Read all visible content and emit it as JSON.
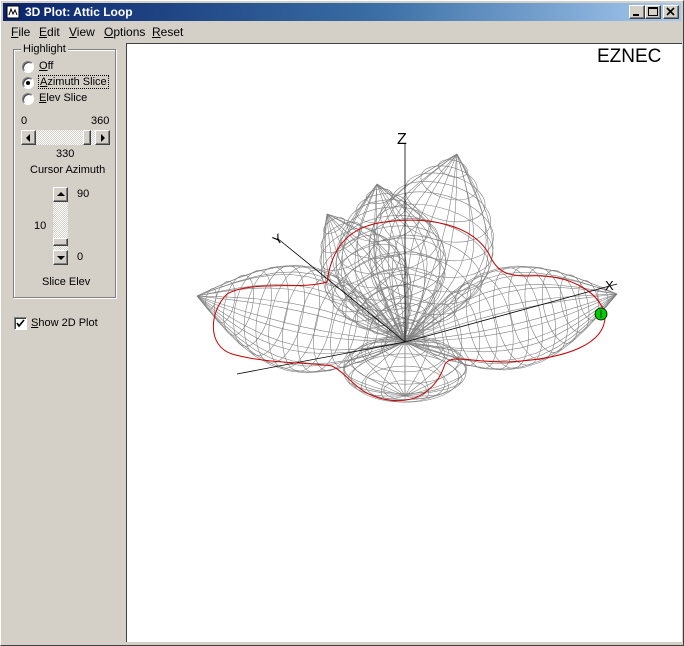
{
  "window": {
    "title": "3D Plot: Attic Loop"
  },
  "menu": [
    {
      "label": "File",
      "key": "F",
      "rest": "ile"
    },
    {
      "label": "Edit",
      "key": "E",
      "rest": "dit"
    },
    {
      "label": "View",
      "key": "V",
      "rest": "iew"
    },
    {
      "label": "Options",
      "key": "O",
      "rest": "ptions"
    },
    {
      "label": "Reset",
      "key": "R",
      "rest": "eset"
    }
  ],
  "highlight": {
    "legend": "Highlight",
    "options": [
      {
        "label": "Off",
        "key": "O",
        "rest": "ff",
        "selected": false
      },
      {
        "label": "Azimuth Slice",
        "key": "A",
        "rest": "zimuth Slice",
        "selected": true
      },
      {
        "label": "Elev Slice",
        "key": "E",
        "rest": "lev Slice",
        "selected": false
      }
    ]
  },
  "azimuth": {
    "min_label": "0",
    "max_label": "360",
    "value_text": "330",
    "value": 330,
    "min": 0,
    "max": 360,
    "caption": "Cursor Azimuth"
  },
  "elevation": {
    "max_label": "90",
    "value_text": "10",
    "min_label": "0",
    "value": 10,
    "min": 0,
    "max": 90,
    "caption": "Slice Elev"
  },
  "show_2d": {
    "label": "Show 2D Plot",
    "key": "S",
    "rest": "how 2D Plot",
    "checked": true
  },
  "plot": {
    "brand": "EZNEC",
    "axis_z": "Z",
    "axis_y": "Y",
    "axis_x": "X",
    "wire_color": "#808080",
    "slice_color": "#cc0000",
    "cursor_color": "#00cc00"
  },
  "colors": {
    "titlebar_start": "#0a246a",
    "titlebar_end": "#a6caf0",
    "face": "#d4d0c8"
  }
}
